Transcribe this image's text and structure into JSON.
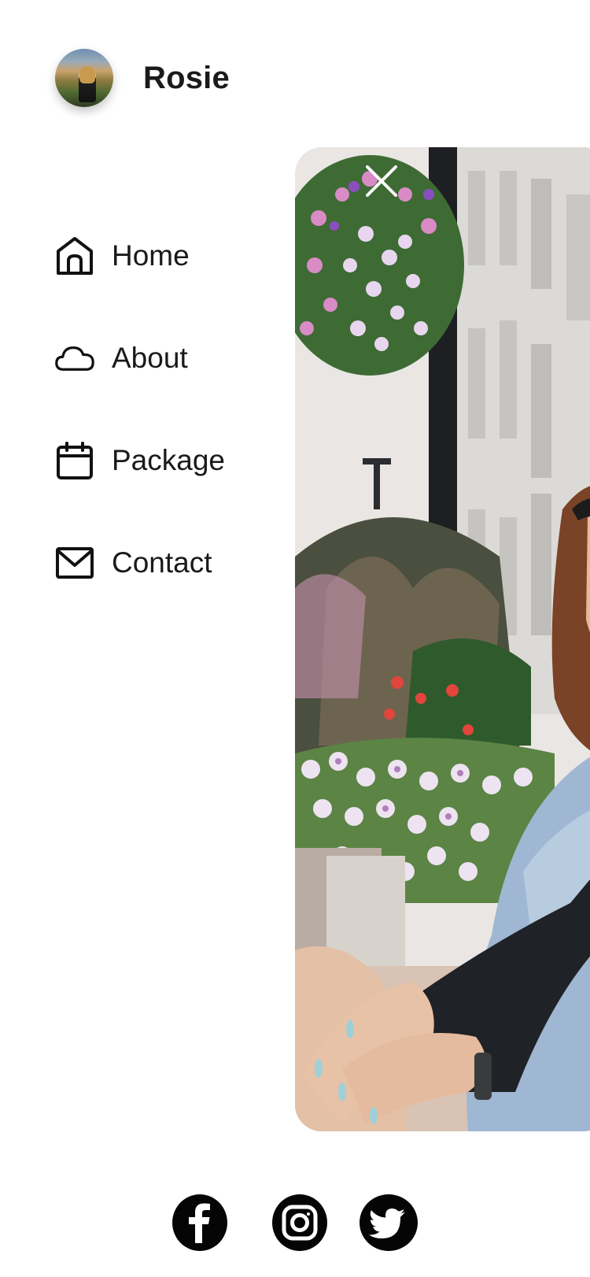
{
  "header": {
    "name": "Rosie",
    "avatar_icon": "profile-photo"
  },
  "nav": {
    "items": [
      {
        "label": "Home",
        "icon": "home-icon"
      },
      {
        "label": "About",
        "icon": "cloud-icon"
      },
      {
        "label": "Package",
        "icon": "calendar-icon"
      },
      {
        "label": "Contact",
        "icon": "mail-icon"
      }
    ]
  },
  "hero": {
    "close_icon": "close-icon"
  },
  "social": {
    "icons": [
      "facebook-icon",
      "instagram-icon",
      "twitter-icon"
    ]
  },
  "colors": {
    "text": "#1a1a1a",
    "background": "#ffffff",
    "social_bg": "#050505"
  }
}
